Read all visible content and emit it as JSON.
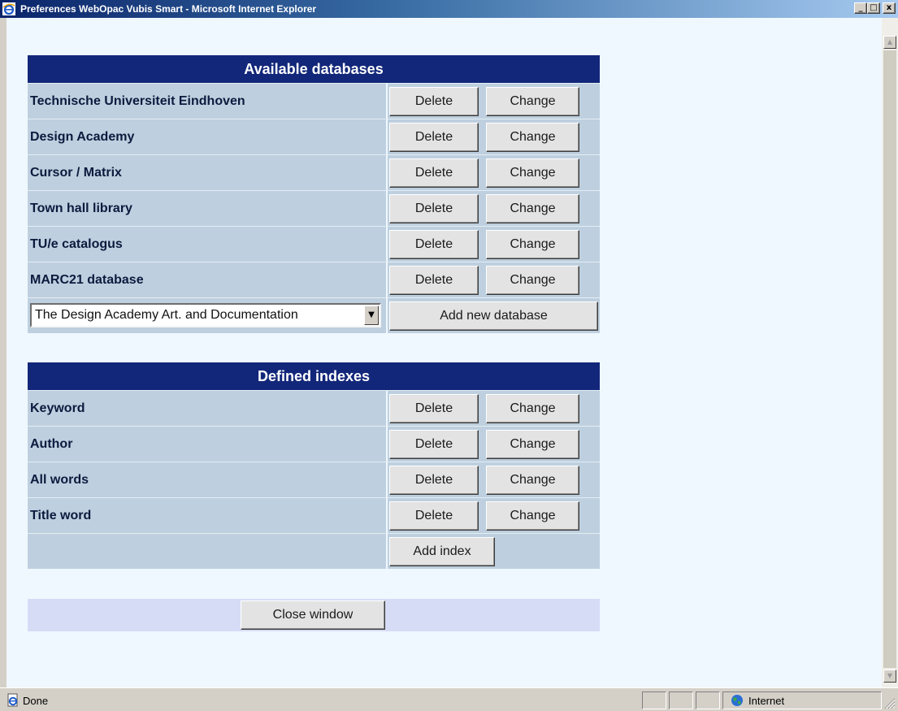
{
  "window": {
    "title": "Preferences WebOpac Vubis Smart - Microsoft Internet Explorer",
    "minimize": "_",
    "maximize": "□",
    "close": "x"
  },
  "icons": {
    "app": "ie-icon",
    "status": "page-done-icon",
    "zone": "globe-icon",
    "dropdown": "▼"
  },
  "databases": {
    "heading": "Available databases",
    "rows": [
      {
        "name": "Technische Universiteit Eindhoven",
        "delete": "Delete",
        "change": "Change"
      },
      {
        "name": "Design Academy",
        "delete": "Delete",
        "change": "Change"
      },
      {
        "name": "Cursor / Matrix",
        "delete": "Delete",
        "change": "Change"
      },
      {
        "name": "Town hall library",
        "delete": "Delete",
        "change": "Change"
      },
      {
        "name": "TU/e catalogus",
        "delete": "Delete",
        "change": "Change"
      },
      {
        "name": "MARC21 database",
        "delete": "Delete",
        "change": "Change"
      }
    ],
    "select_value": "The Design Academy Art. and Documentation",
    "add_label": "Add new database"
  },
  "indexes": {
    "heading": "Defined indexes",
    "rows": [
      {
        "name": "Keyword",
        "delete": "Delete",
        "change": "Change"
      },
      {
        "name": "Author",
        "delete": "Delete",
        "change": "Change"
      },
      {
        "name": "All words",
        "delete": "Delete",
        "change": "Change"
      },
      {
        "name": "Title word",
        "delete": "Delete",
        "change": "Change"
      }
    ],
    "add_label": "Add index"
  },
  "close_label": "Close window",
  "status": {
    "text": "Done",
    "zone": "Internet"
  },
  "colors": {
    "header_bg": "#12277a",
    "row_bg": "#bed0df",
    "page_bg": "#f0f8ff",
    "close_bar_bg": "#d6dcf6"
  }
}
